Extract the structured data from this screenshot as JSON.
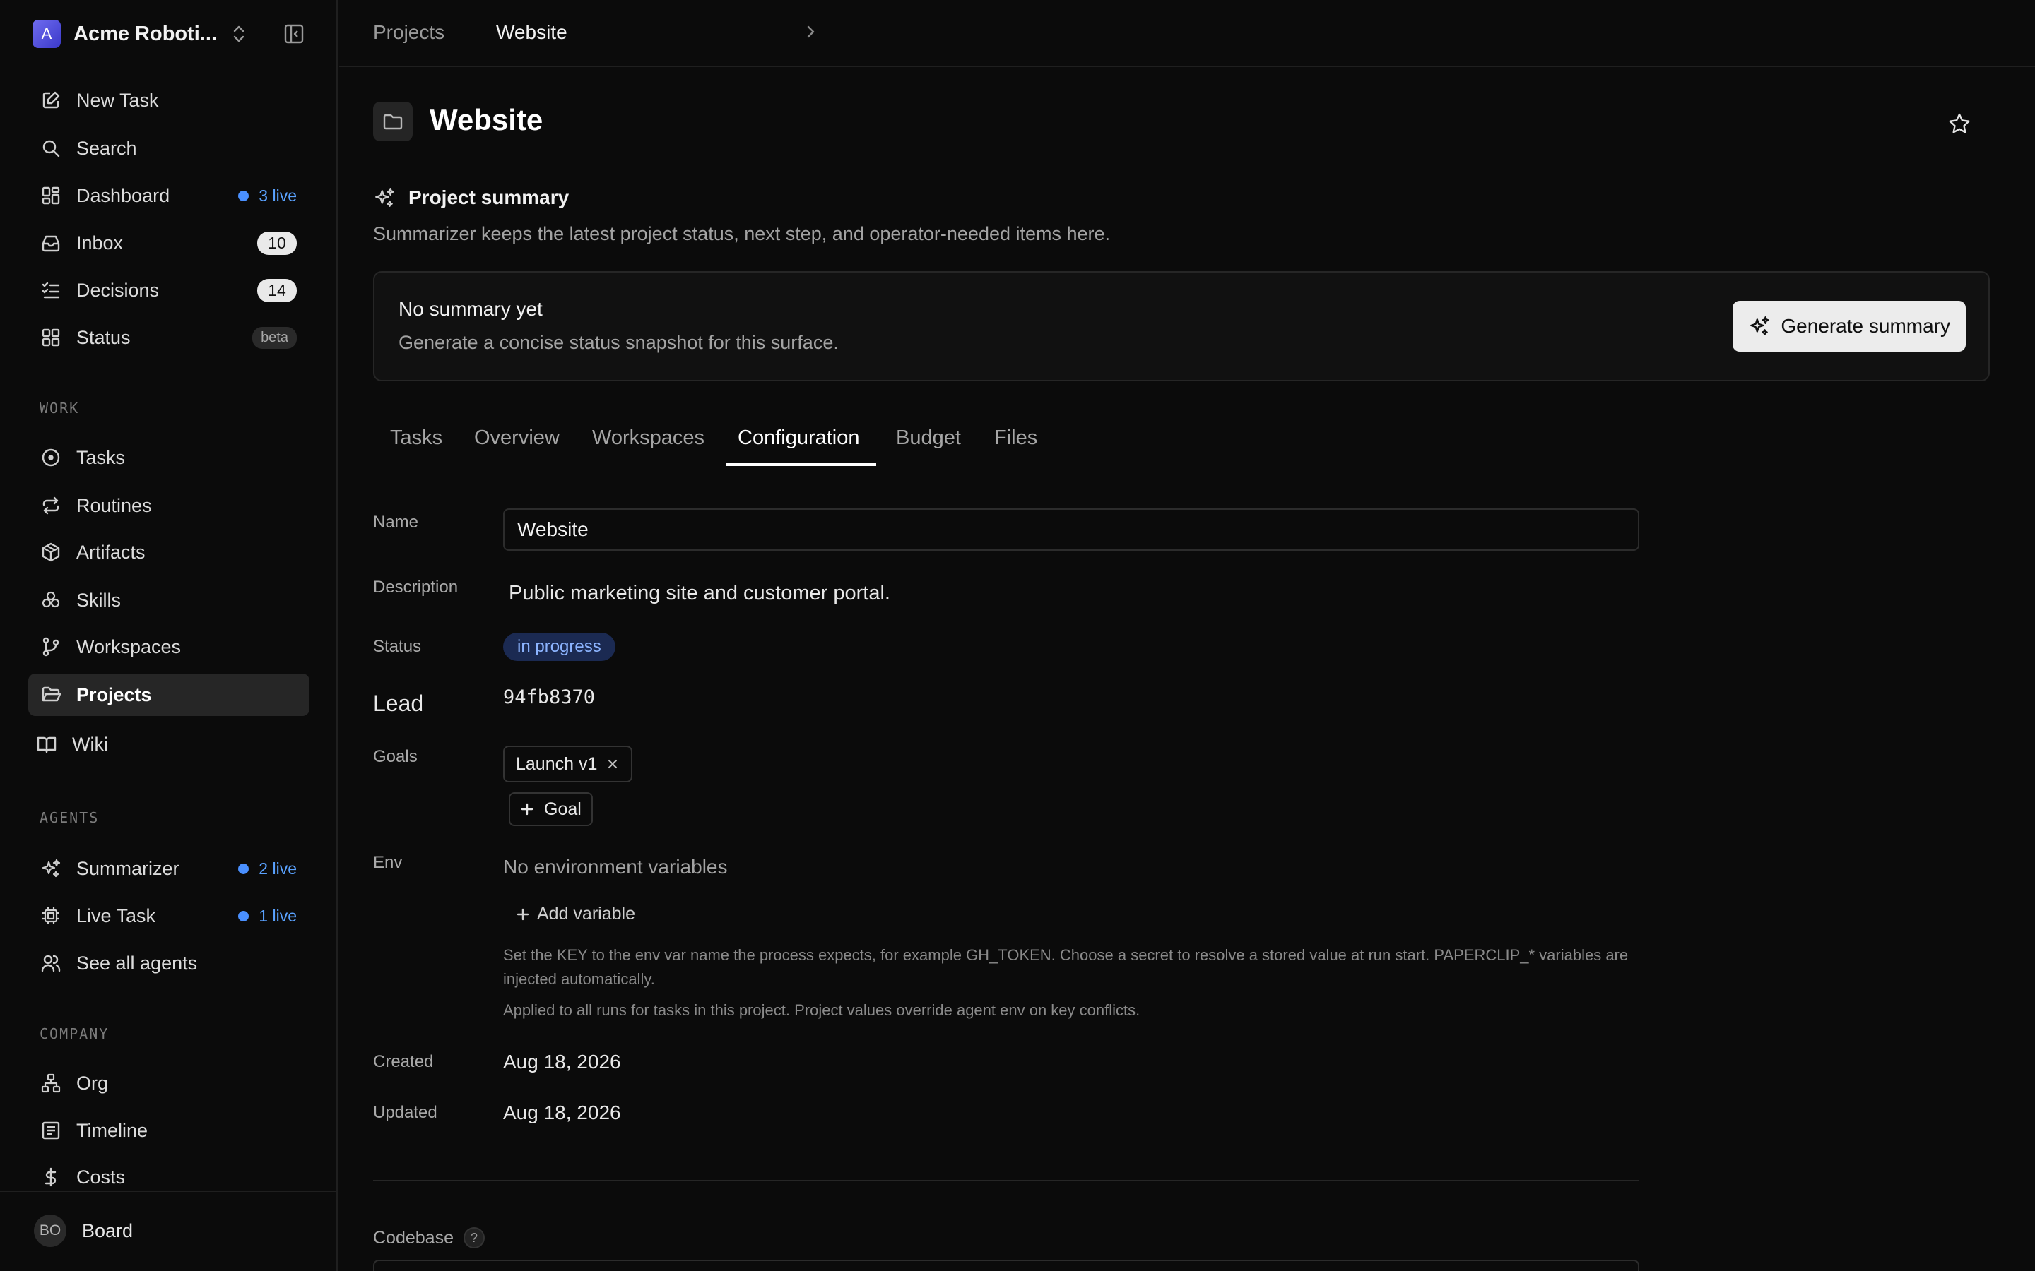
{
  "sidebar": {
    "company": {
      "initial": "A",
      "name": "Acme Roboti..."
    },
    "nav": [
      {
        "label": "New Task"
      },
      {
        "label": "Search"
      },
      {
        "label": "Dashboard",
        "live": "3 live"
      },
      {
        "label": "Inbox",
        "count": "10"
      },
      {
        "label": "Decisions",
        "count": "14"
      },
      {
        "label": "Status",
        "badge": "beta"
      }
    ],
    "work_label": "WORK",
    "work": [
      {
        "label": "Tasks"
      },
      {
        "label": "Routines"
      },
      {
        "label": "Artifacts"
      },
      {
        "label": "Skills"
      },
      {
        "label": "Workspaces"
      },
      {
        "label": "Projects"
      },
      {
        "label": "Wiki"
      }
    ],
    "agents_label": "AGENTS",
    "agents": [
      {
        "label": "Summarizer",
        "live": "2 live"
      },
      {
        "label": "Live Task",
        "live": "1 live"
      },
      {
        "label": "See all agents"
      }
    ],
    "company_label": "COMPANY",
    "company_items": [
      {
        "label": "Org"
      },
      {
        "label": "Timeline"
      },
      {
        "label": "Costs"
      }
    ],
    "user": {
      "initials": "BO",
      "name": "Board"
    },
    "active_item": "Projects",
    "live_color": "#4a90ff"
  },
  "breadcrumb": {
    "parent": "Projects",
    "current": "Website"
  },
  "page": {
    "title": "Website"
  },
  "summary": {
    "heading": "Project summary",
    "subtitle": "Summarizer keeps the latest project status, next step, and operator-needed items here.",
    "card_title": "No summary yet",
    "card_subtitle": "Generate a concise status snapshot for this surface.",
    "button": "Generate summary"
  },
  "tabs": [
    {
      "label": "Tasks"
    },
    {
      "label": "Overview"
    },
    {
      "label": "Workspaces"
    },
    {
      "label": "Configuration"
    },
    {
      "label": "Budget"
    },
    {
      "label": "Files"
    }
  ],
  "active_tab": "Configuration",
  "config": {
    "name_label": "Name",
    "name_value": "Website",
    "description_label": "Description",
    "description_value": "Public marketing site and customer portal.",
    "status_label": "Status",
    "status_value": "in progress",
    "lead_label": "Lead",
    "lead_value": "94fb8370",
    "goals_label": "Goals",
    "goals": [
      "Launch v1"
    ],
    "add_goal": "Goal",
    "env_label": "Env",
    "env_empty": "No environment variables",
    "add_variable": "Add variable",
    "env_help": "Set the KEY to the env var name the process expects, for example GH_TOKEN. Choose a secret to resolve a stored value at run start. PAPERCLIP_* variables are injected automatically.",
    "env_help2": "Applied to all runs for tasks in this project. Project values override agent env on key conflicts.",
    "created_label": "Created",
    "created_value": "Aug 18, 2026",
    "updated_label": "Updated",
    "updated_value": "Aug 18, 2026",
    "codebase_label": "Codebase",
    "codebase_help": "?"
  }
}
